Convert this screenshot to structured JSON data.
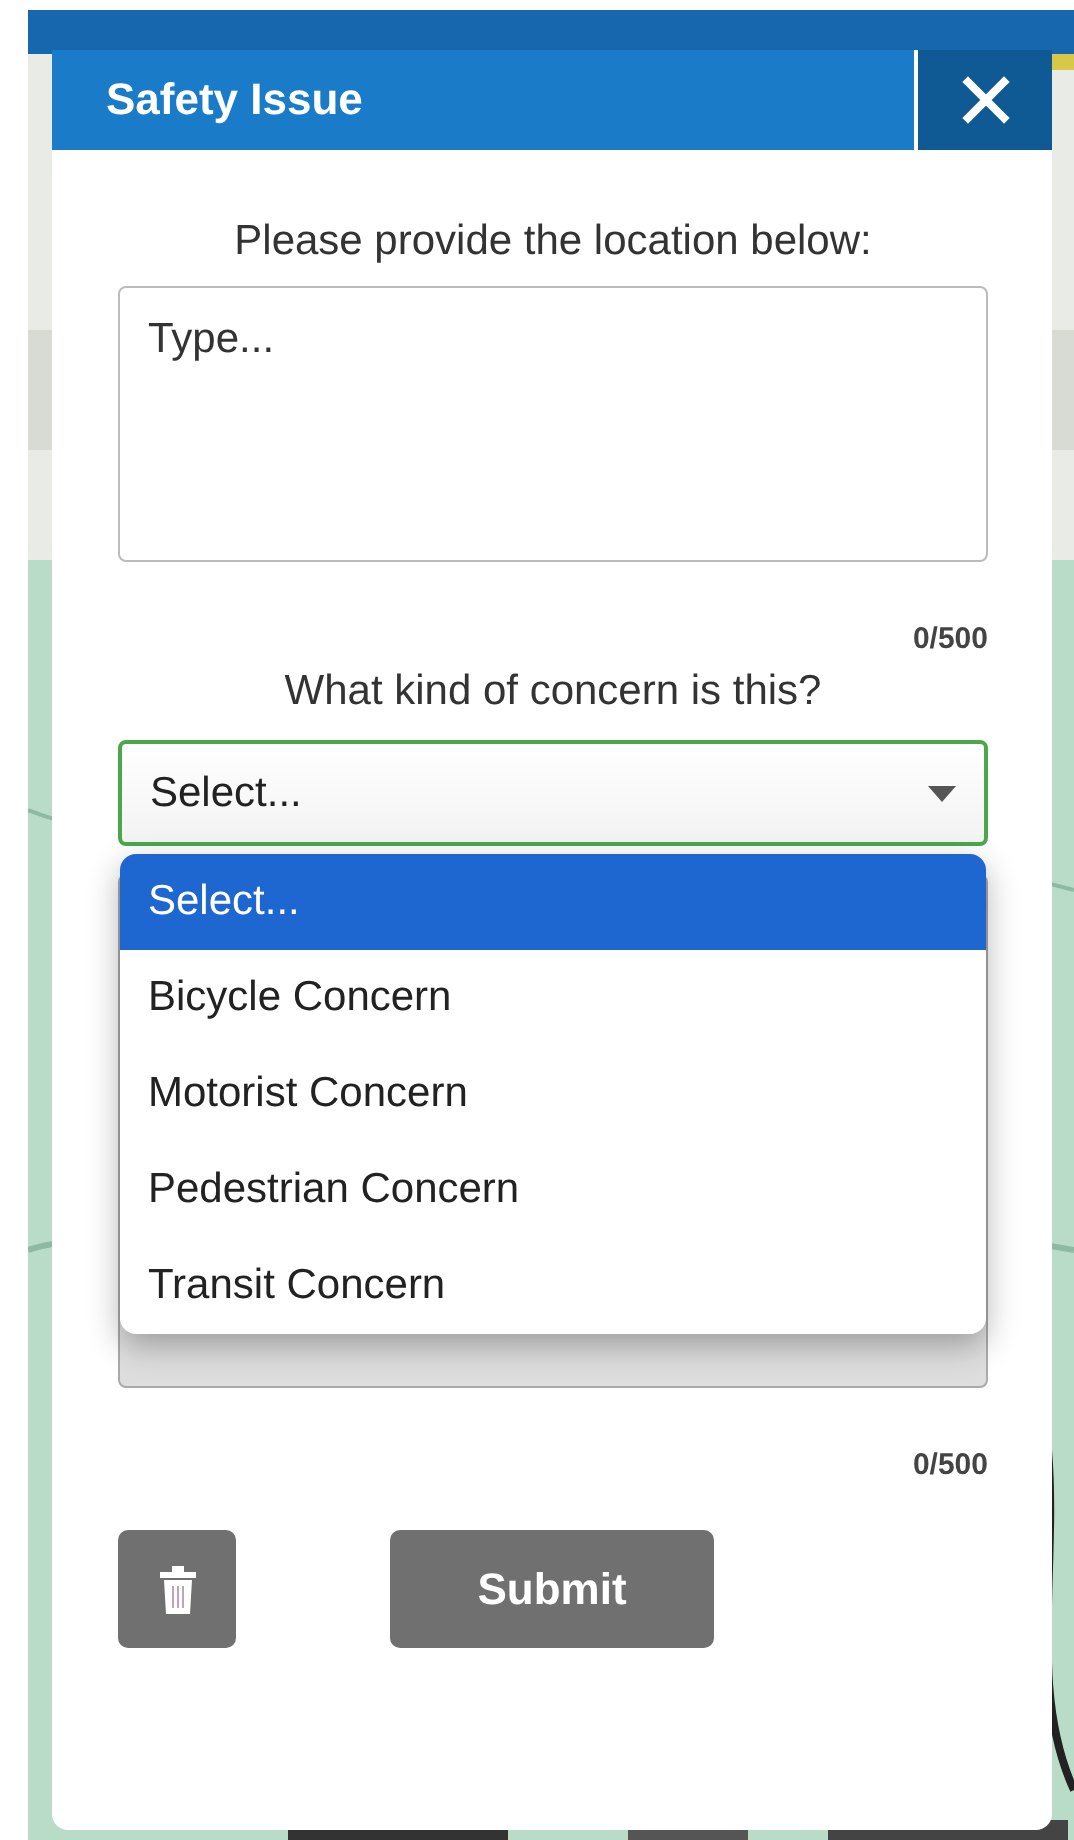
{
  "dialog": {
    "title": "Safety Issue"
  },
  "location": {
    "label": "Please provide the location below:",
    "placeholder": "Type...",
    "counter": "0/500"
  },
  "concern": {
    "label": "What kind of concern is this?",
    "value": "Select...",
    "open": true,
    "options": [
      {
        "label": "Select...",
        "selected": true
      },
      {
        "label": "Bicycle Concern",
        "selected": false
      },
      {
        "label": "Motorist Concern",
        "selected": false
      },
      {
        "label": "Pedestrian Concern",
        "selected": false
      },
      {
        "label": "Transit Concern",
        "selected": false
      }
    ]
  },
  "details": {
    "counter": "0/500"
  },
  "buttons": {
    "submit": "Submit"
  }
}
